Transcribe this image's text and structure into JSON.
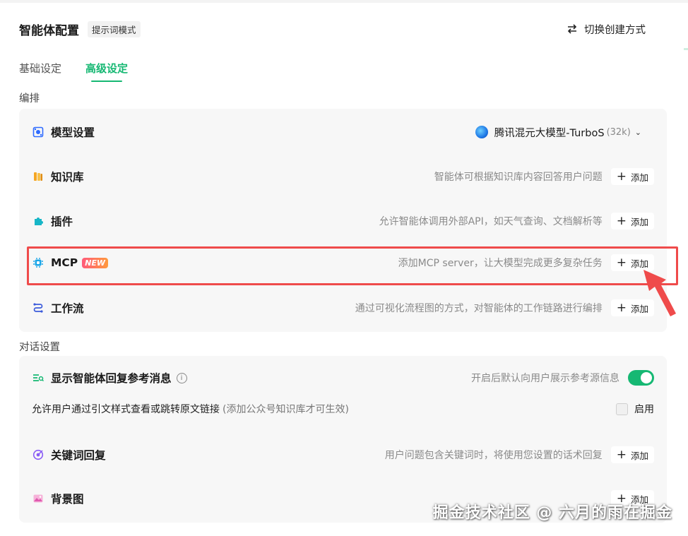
{
  "header": {
    "title": "智能体配置",
    "mode_badge": "提示词模式",
    "switch_label": "切换创建方式"
  },
  "tabs": [
    {
      "label": "基础设定",
      "active": false
    },
    {
      "label": "高级设定",
      "active": true
    }
  ],
  "arrange": {
    "section_label": "编排",
    "model": {
      "title": "模型设置",
      "selected_model": "腾讯混元大模型-TurboS",
      "context": "(32k)"
    },
    "rows": [
      {
        "title": "知识库",
        "desc": "智能体可根据知识库内容回答用户问题",
        "add_label": "添加"
      },
      {
        "title": "插件",
        "desc": "允许智能体调用外部API，如天气查询、文档解析等",
        "add_label": "添加"
      },
      {
        "title": "MCP",
        "badge": "NEW",
        "desc": "添加MCP server，让大模型完成更多复杂任务",
        "add_label": "添加"
      },
      {
        "title": "工作流",
        "desc": "通过可视化流程图的方式，对智能体的工作链路进行编排",
        "add_label": "添加"
      }
    ]
  },
  "dialog": {
    "section_label": "对话设置",
    "reference": {
      "title": "显示智能体回复参考消息",
      "info": "i",
      "desc": "开启后默认向用户展示参考源信息",
      "toggle_on": true,
      "sub_text": "允许用户通过引文样式查看或跳转原文链接",
      "sub_note": "(添加公众号知识库才可生效)",
      "checkbox_label": "启用",
      "checkbox_checked": false
    },
    "rows": [
      {
        "title": "关键词回复",
        "desc": "用户问题包含关键词时，将使用您设置的话术回复",
        "add_label": "添加"
      },
      {
        "title": "背景图",
        "desc": "",
        "add_label": "添加"
      }
    ]
  },
  "watermark": "掘金技术社区 @ 六月的雨在掘金",
  "colors": {
    "accent": "#16b873",
    "highlight": "#ef4b4b",
    "panel_bg": "#f7f7f7"
  }
}
